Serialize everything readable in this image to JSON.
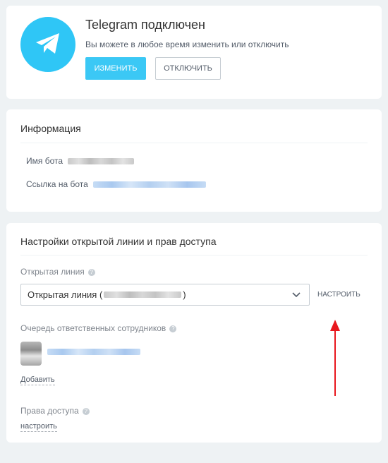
{
  "status": {
    "title": "Telegram подключен",
    "subtitle": "Вы можете в любое время изменить или отключить",
    "change_label": "изменить",
    "disconnect_label": "отключить",
    "brand_color": "#2fc6f6"
  },
  "info": {
    "title": "Информация",
    "bot_name_label": "Имя бота",
    "bot_link_label": "Ссылка на бота"
  },
  "settings": {
    "title": "Настройки открытой линии и прав доступа",
    "open_line_label": "Открытая линия",
    "open_line_value_prefix": "Открытая линия (",
    "open_line_value_suffix": ")",
    "configure_label": "настроить",
    "queue_label": "Очередь ответственных сотрудников",
    "add_label": "Добавить",
    "access_label": "Права доступа",
    "access_configure_label": "настроить"
  },
  "help_glyph": "?",
  "annotation": {
    "arrow_color": "#e8181e"
  }
}
